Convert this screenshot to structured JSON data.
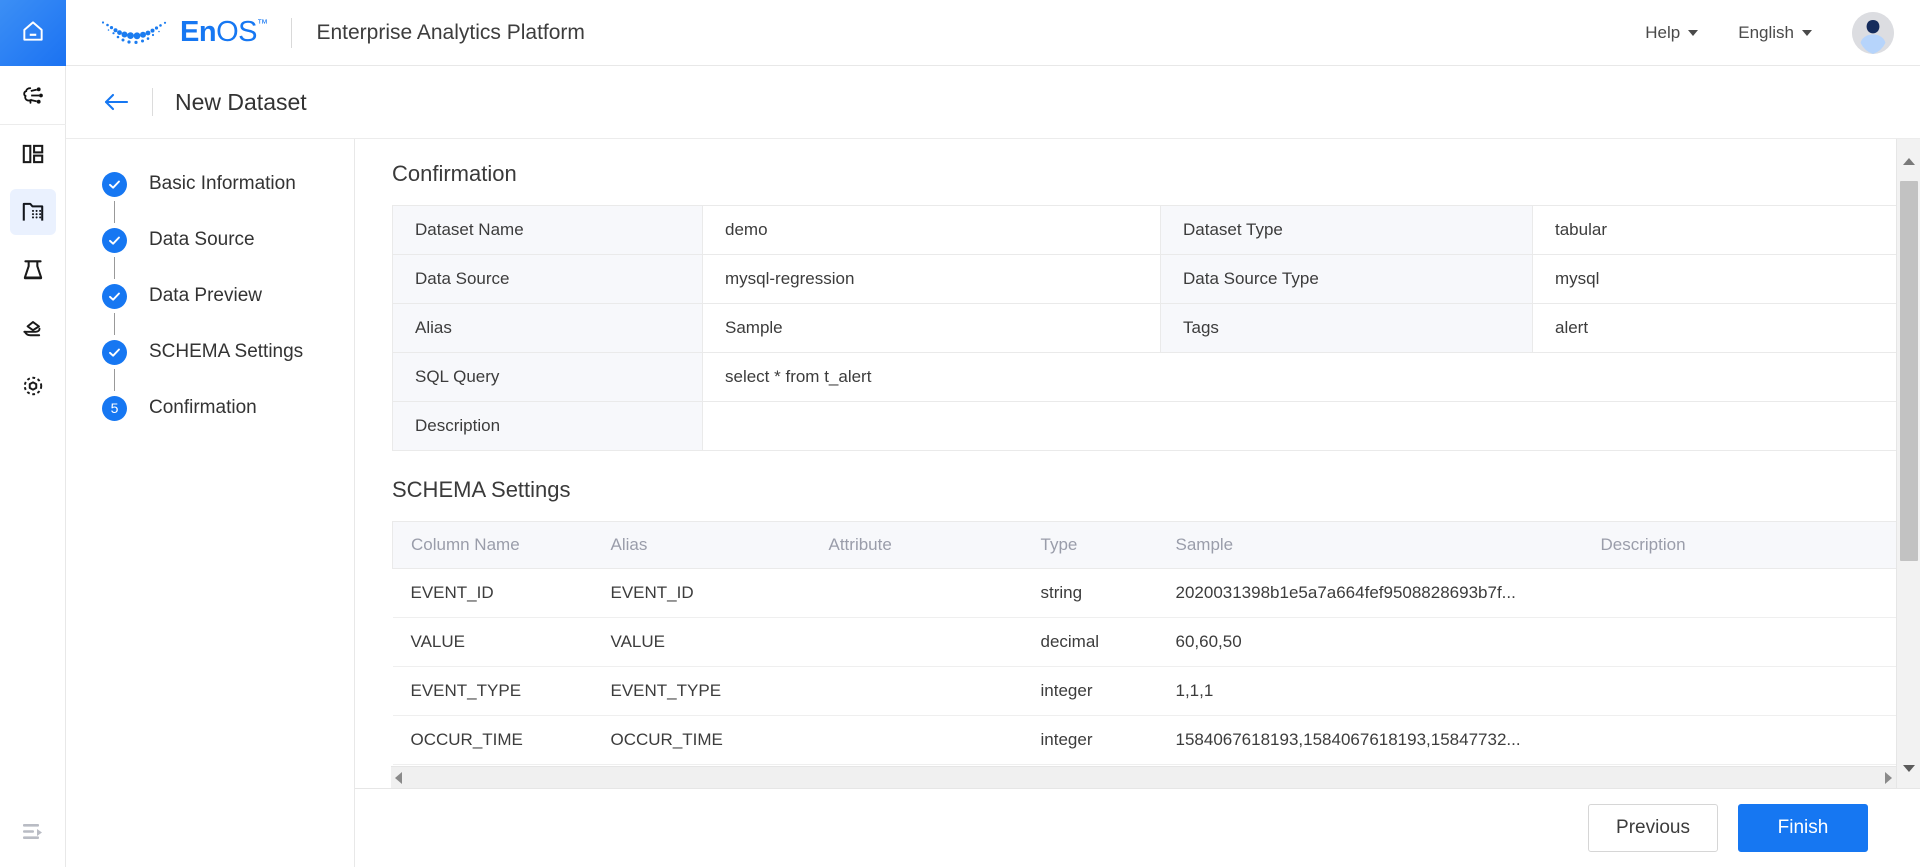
{
  "header": {
    "logo_text_en": "En",
    "logo_text_os": "OS",
    "logo_tm": "™",
    "product_title": "Enterprise Analytics Platform",
    "help_label": "Help",
    "language_label": "English"
  },
  "subheader": {
    "title": "New Dataset"
  },
  "rail": {
    "home_icon": "home-icon",
    "items": [
      {
        "icon": "ai-model-icon",
        "name": "ai-model"
      },
      {
        "icon": "dashboard-icon",
        "name": "dashboard"
      },
      {
        "icon": "dataset-folder-icon",
        "name": "dataset",
        "active": true
      },
      {
        "icon": "lab-flask-icon",
        "name": "experiment"
      },
      {
        "icon": "deploy-icon",
        "name": "deployment"
      },
      {
        "icon": "settings-gear-icon",
        "name": "settings"
      }
    ],
    "bottom_icon": "collapse-panel-icon"
  },
  "steps": [
    {
      "marker": "✓",
      "label": "Basic Information",
      "done": true
    },
    {
      "marker": "✓",
      "label": "Data Source",
      "done": true
    },
    {
      "marker": "✓",
      "label": "Data Preview",
      "done": true
    },
    {
      "marker": "✓",
      "label": "SCHEMA Settings",
      "done": true
    },
    {
      "marker": "5",
      "label": "Confirmation",
      "done": false
    }
  ],
  "confirmation": {
    "title": "Confirmation",
    "rows": [
      {
        "label1": "Dataset Name",
        "value1": "demo",
        "label2": "Dataset Type",
        "value2": "tabular"
      },
      {
        "label1": "Data Source",
        "value1": "mysql-regression",
        "label2": "Data Source Type",
        "value2": "mysql"
      },
      {
        "label1": "Alias",
        "value1": "Sample",
        "label2": "Tags",
        "value2": "alert"
      }
    ],
    "sql_label": "SQL Query",
    "sql_value": "select * from t_alert",
    "description_label": "Description",
    "description_value": ""
  },
  "schema": {
    "title": "SCHEMA Settings",
    "columns": [
      "Column Name",
      "Alias",
      "Attribute",
      "Type",
      "Sample",
      "Description"
    ],
    "rows": [
      {
        "column_name": "EVENT_ID",
        "alias": "EVENT_ID",
        "attribute": "",
        "type": "string",
        "sample": "2020031398b1e5a7a664fef9508828693b7f...",
        "description": ""
      },
      {
        "column_name": "VALUE",
        "alias": "VALUE",
        "attribute": "",
        "type": "decimal",
        "sample": "60,60,50",
        "description": ""
      },
      {
        "column_name": "EVENT_TYPE",
        "alias": "EVENT_TYPE",
        "attribute": "",
        "type": "integer",
        "sample": "1,1,1",
        "description": ""
      },
      {
        "column_name": "OCCUR_TIME",
        "alias": "OCCUR_TIME",
        "attribute": "",
        "type": "integer",
        "sample": "1584067618193,1584067618193,15847732...",
        "description": ""
      }
    ]
  },
  "footer": {
    "previous_label": "Previous",
    "finish_label": "Finish"
  },
  "colors": {
    "accent": "#1677f2",
    "label_cell_bg": "#f7f8fb",
    "header_text": "#9a9daa"
  }
}
